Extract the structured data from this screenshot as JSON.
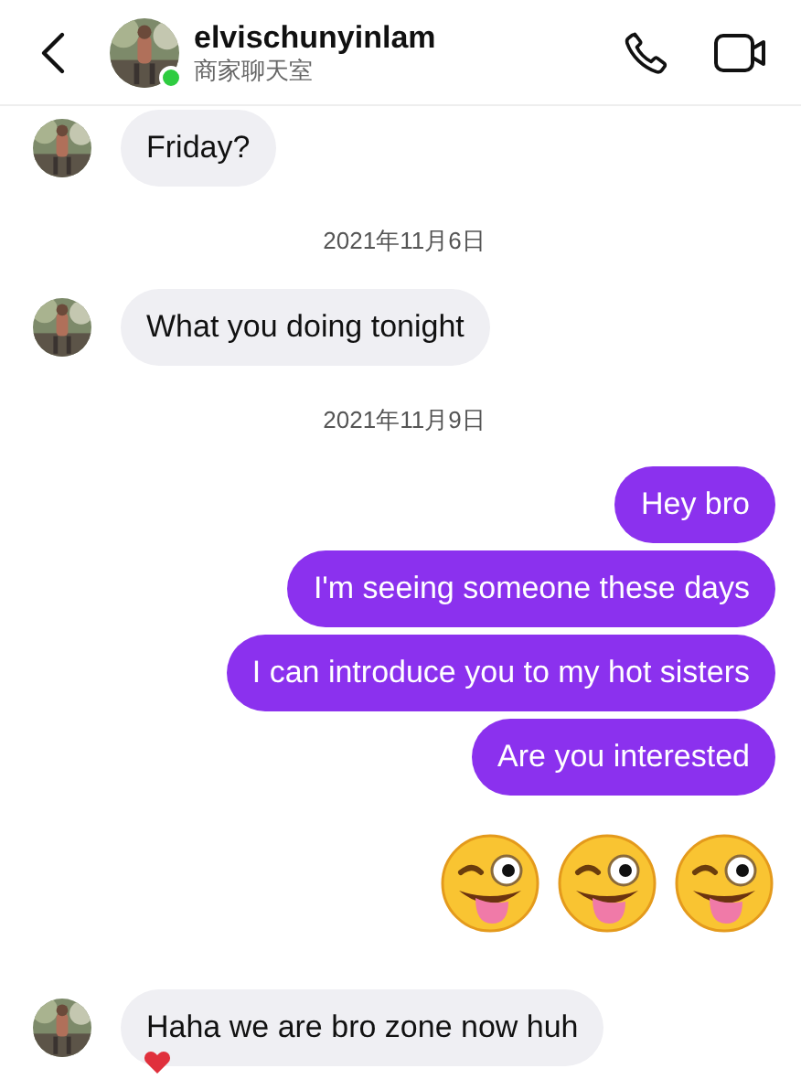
{
  "header": {
    "username": "elvischunyinlam",
    "subtitle": "商家聊天室",
    "online": true
  },
  "messages": [
    {
      "kind": "incoming",
      "text": "Friday?",
      "reacted": false
    },
    {
      "kind": "date",
      "text": "2021年11月6日"
    },
    {
      "kind": "incoming",
      "text": "What you doing tonight",
      "reacted": false
    },
    {
      "kind": "date",
      "text": "2021年11月9日"
    },
    {
      "kind": "outgoing",
      "text": "Hey bro"
    },
    {
      "kind": "outgoing",
      "text": "I'm seeing someone these days"
    },
    {
      "kind": "outgoing",
      "text": "I can introduce you to my hot sisters"
    },
    {
      "kind": "outgoing",
      "text": "Are you interested"
    },
    {
      "kind": "emoji"
    },
    {
      "kind": "emoji"
    },
    {
      "kind": "emoji"
    },
    {
      "kind": "incoming",
      "text": "Haha we are bro zone now huh",
      "reacted": true
    }
  ]
}
